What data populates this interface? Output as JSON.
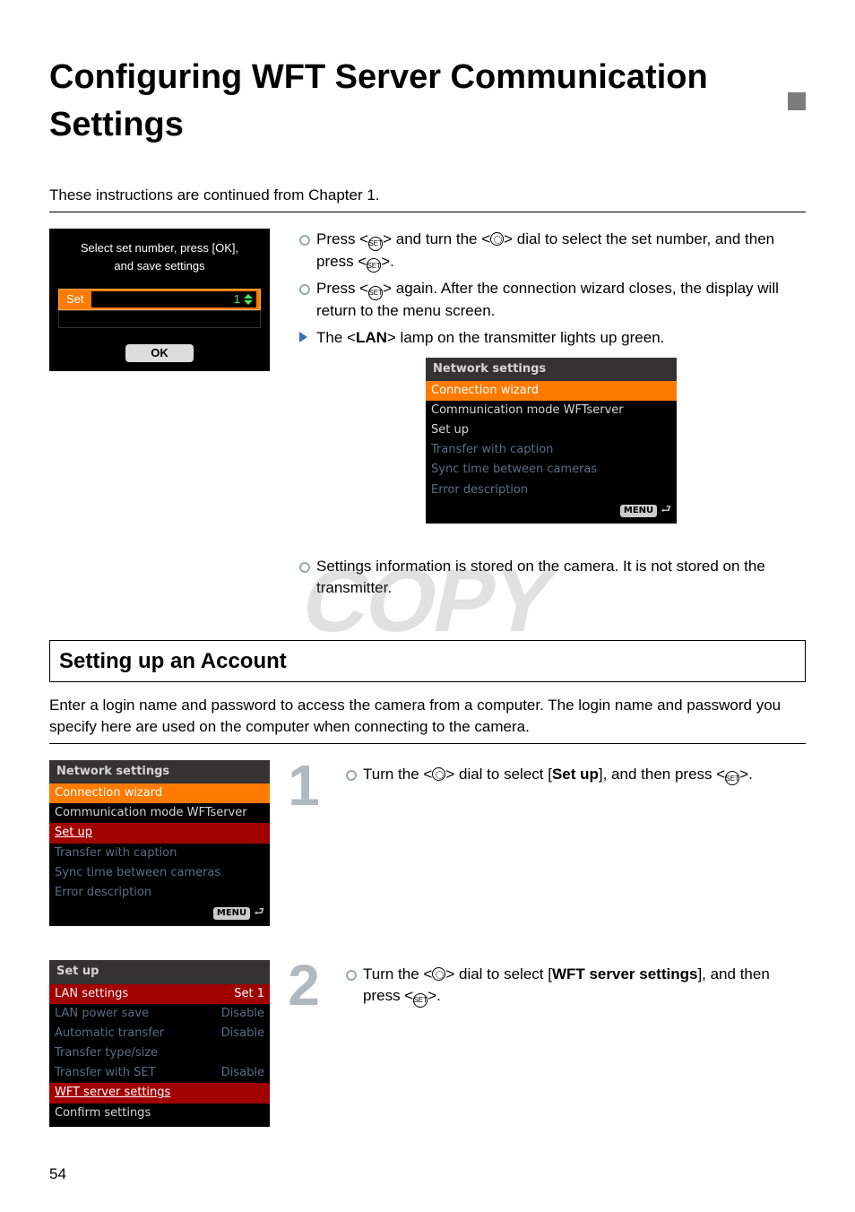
{
  "title": "Configuring WFT Server Communication Settings",
  "intro": "These instructions are continued from Chapter 1.",
  "lcd_set": {
    "msg1": "Select set number, press [OK],",
    "msg2": "and save settings",
    "set_label": "Set",
    "set_value": "1",
    "ok": "OK"
  },
  "bullets_top": {
    "b1a": "Press <",
    "b1b": "> and turn the <",
    "b1c": "> dial to select the set number, and then press <",
    "b1d": ">.",
    "b2a": "Press <",
    "b2b": "> again. After the connection wizard closes, the display will return to the menu screen.",
    "t1a": "The <",
    "t1b": "LAN",
    "t1c": "> lamp on the transmitter lights up green."
  },
  "lcd_net": {
    "title": "Network settings",
    "sel": "Connection wizard",
    "l1": "Communication mode WFTserver",
    "l2": "Set up",
    "d1": "Transfer with caption",
    "d2": "Sync time between cameras",
    "d3": "Error description",
    "menu": "MENU"
  },
  "bottom_note": "Settings information is stored on the camera. It is not stored on the transmitter.",
  "section_head": "Setting up an Account",
  "section_intro": "Enter a login name and password to access the camera from a computer. The login name and password you specify here are used on the computer when connecting to the camera.",
  "step1": {
    "num": "1",
    "t1a": "Turn the <",
    "t1b": "> dial to select [",
    "t1c": "Set up",
    "t1d": "], and then press <",
    "t1e": ">.",
    "lcd": {
      "title": "Network settings",
      "sel": "Connection wizard",
      "l1": "Communication mode WFTserver",
      "hl": "Set up",
      "d1": "Transfer with caption",
      "d2": "Sync time between cameras",
      "d3": "Error description",
      "menu": "MENU"
    }
  },
  "step2": {
    "num": "2",
    "t1a": "Turn the <",
    "t1b": "> dial to select [",
    "t1c": "WFT server settings",
    "t1d": "], and then press <",
    "t1e": ">.",
    "lcd": {
      "title": "Set up",
      "r1l": "LAN settings",
      "r1v": "Set 1",
      "r2l": "LAN power save",
      "r2v": "Disable",
      "r3l": "Automatic transfer",
      "r3v": "Disable",
      "r4l": "Transfer type/size",
      "r4v": "",
      "r5l": "Transfer with SET",
      "r5v": "Disable",
      "hl": "WFT server settings",
      "cf": "Confirm settings"
    }
  },
  "watermark": "COPY",
  "page_number": "54",
  "set_icon_text": "SET"
}
